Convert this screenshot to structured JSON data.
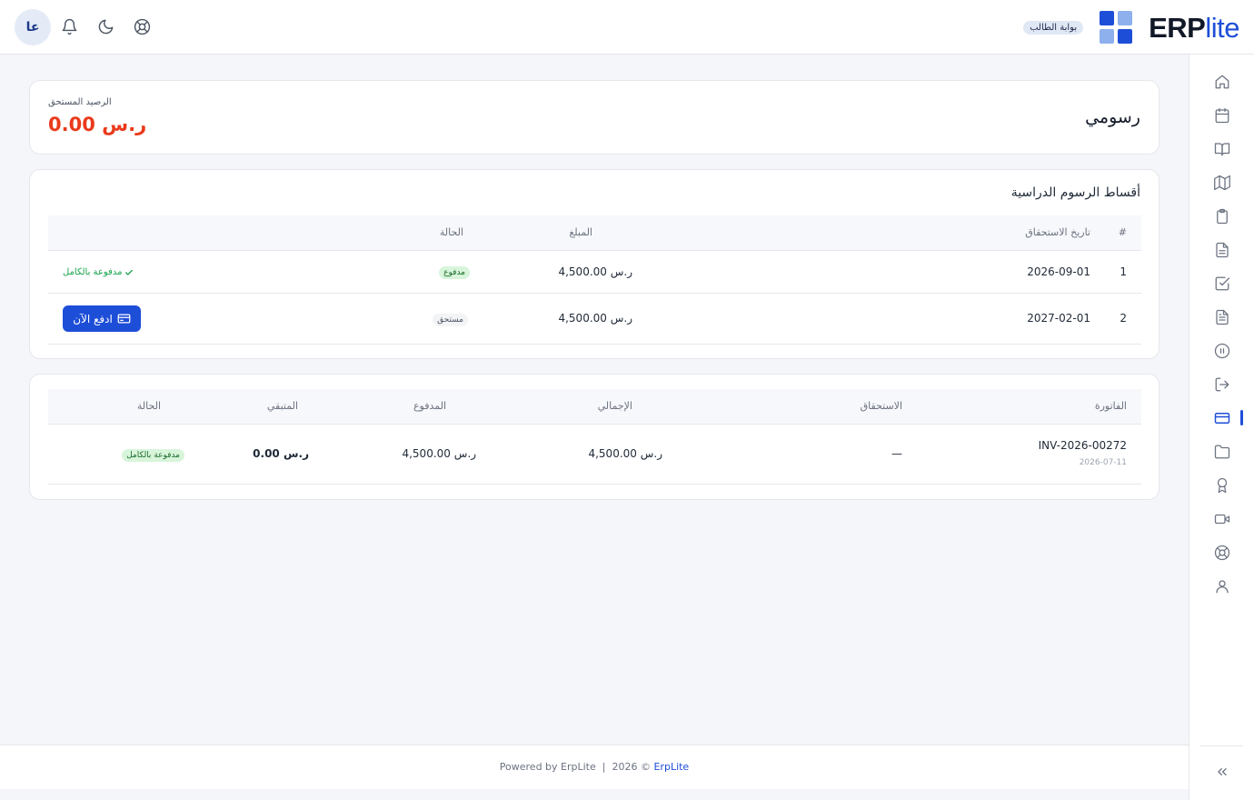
{
  "header": {
    "logo_erp": "ERP",
    "logo_lite": "lite",
    "portal_badge": "بوابة الطالب",
    "avatar_initials": "عا",
    "logo_colors": [
      "#1d4ed8",
      "#8eb0ec",
      "#8eb0ec",
      "#1d4ed8"
    ]
  },
  "sidebar": {
    "items": [
      {
        "icon": "home-icon"
      },
      {
        "icon": "calendar-icon"
      },
      {
        "icon": "book-open-icon"
      },
      {
        "icon": "map-icon"
      },
      {
        "icon": "clipboard-icon"
      },
      {
        "icon": "file-text-icon"
      },
      {
        "icon": "check-square-icon"
      },
      {
        "icon": "file-lines-icon"
      },
      {
        "icon": "pause-circle-icon"
      },
      {
        "icon": "log-out-icon"
      },
      {
        "icon": "credit-card-icon",
        "active": true
      },
      {
        "icon": "folder-icon"
      },
      {
        "icon": "award-icon"
      },
      {
        "icon": "video-icon"
      },
      {
        "icon": "life-buoy-icon"
      },
      {
        "icon": "user-icon"
      }
    ]
  },
  "summary": {
    "title": "رسومي",
    "balance_label": "الرصيد المستحق",
    "balance_value": "0.00 ر.س"
  },
  "installments": {
    "title": "أقساط الرسوم الدراسية",
    "columns": {
      "num": "#",
      "due": "تاريخ الاستحقاق",
      "amount": "المبلغ",
      "status": "الحالة"
    },
    "rows": [
      {
        "num": "1",
        "due": "2026-09-01",
        "amount": "4,500.00 ر.س",
        "status": "مدفوع",
        "note": "مدفوعة بالكامل"
      },
      {
        "num": "2",
        "due": "2027-02-01",
        "amount": "4,500.00 ر.س",
        "status": "مستحق",
        "action": "ادفع الآن"
      }
    ]
  },
  "invoices": {
    "columns": {
      "invoice": "الفاتورة",
      "due": "الاستحقاق",
      "total": "الإجمالي",
      "paid": "المدفوع",
      "remaining": "المتبقي",
      "status": "الحالة"
    },
    "rows": [
      {
        "invoice": "INV-2026-00272",
        "date": "2026-07-11",
        "due": "—",
        "total": "4,500.00 ر.س",
        "paid": "4,500.00 ر.س",
        "remaining": "0.00 ر.س",
        "status": "مدفوعة بالكامل"
      }
    ]
  },
  "footer": {
    "powered": "Powered by ErpLite",
    "separator": "|",
    "year": "2026 ©",
    "brand_link": "ErpLite"
  }
}
